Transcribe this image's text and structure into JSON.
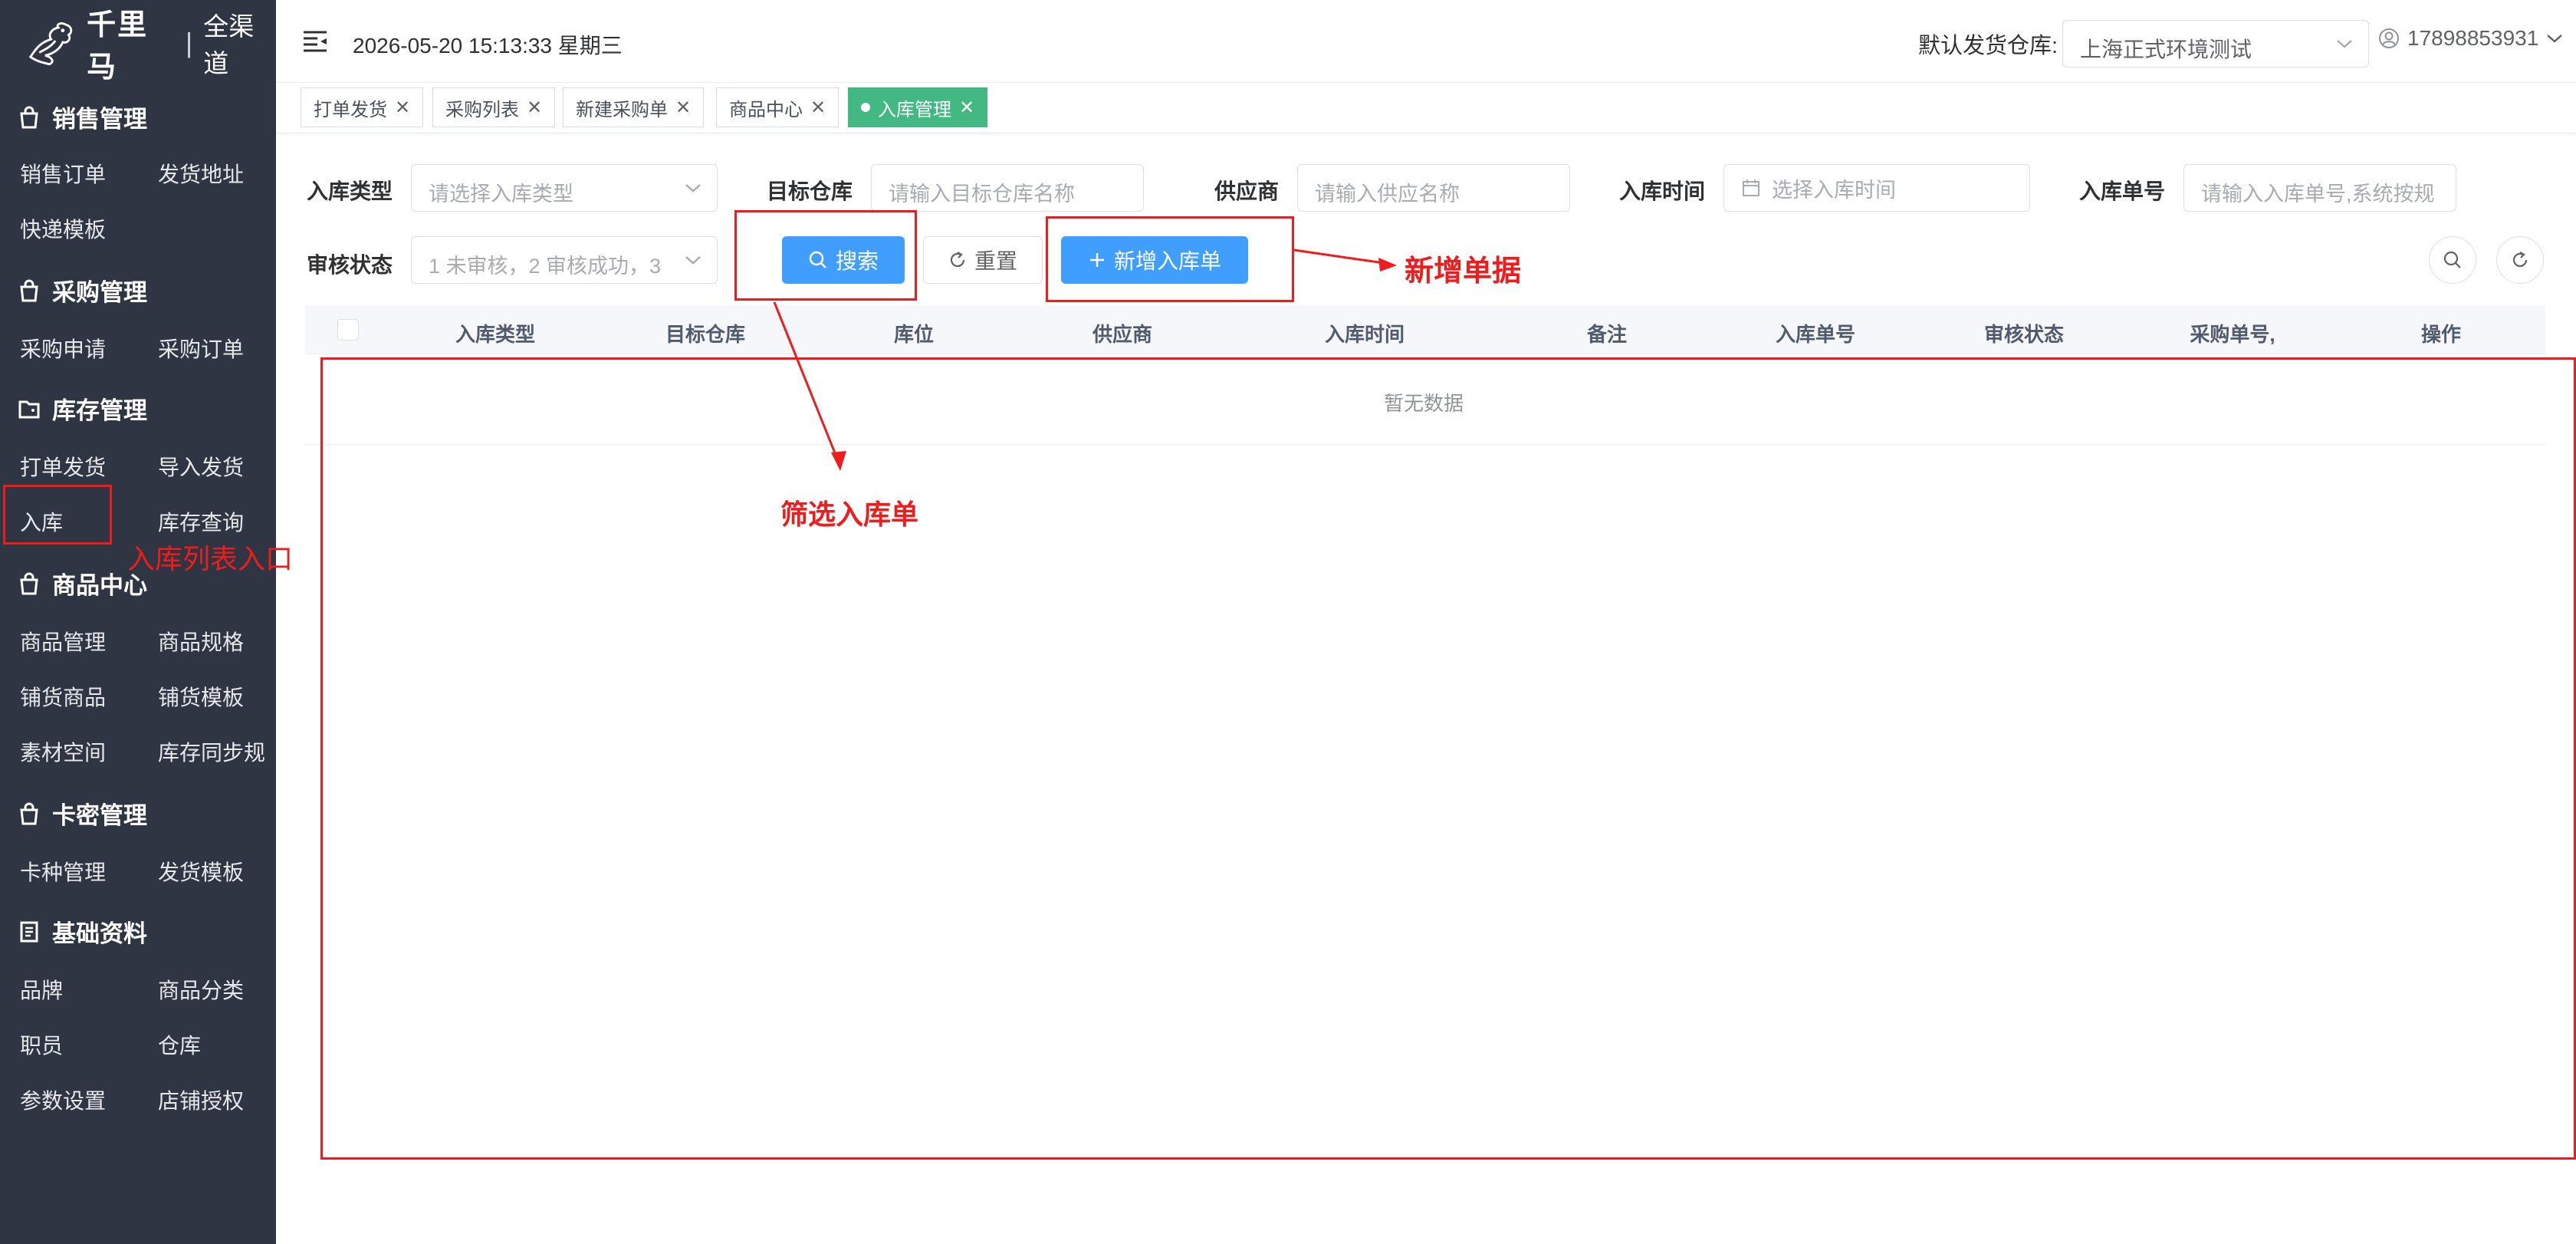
{
  "sidebar": {
    "logo": {
      "brand": "千里马",
      "separator": "|",
      "sub": "全渠道"
    },
    "groups": [
      {
        "title": "销售管理",
        "icon": "bag-icon",
        "items": [
          "销售订单",
          "发货地址",
          "快递模板"
        ]
      },
      {
        "title": "采购管理",
        "icon": "bag-icon",
        "items": [
          "采购申请",
          "采购订单"
        ]
      },
      {
        "title": "库存管理",
        "icon": "folder-icon",
        "items": [
          "打单发货",
          "导入发货",
          "入库",
          "库存查询"
        ]
      },
      {
        "title": "商品中心",
        "icon": "bag-icon",
        "items": [
          "商品管理",
          "商品规格",
          "铺货商品",
          "铺货模板",
          "素材空间",
          "库存同步规"
        ]
      },
      {
        "title": "卡密管理",
        "icon": "bag-icon",
        "items": [
          "卡种管理",
          "发货模板"
        ]
      },
      {
        "title": "基础资料",
        "icon": "document-icon",
        "items": [
          "品牌",
          "商品分类",
          "职员",
          "仓库",
          "参数设置",
          "店铺授权"
        ]
      }
    ]
  },
  "header": {
    "datetime": "2026-05-20 15:13:33 星期三",
    "warehouse_label": "默认发货仓库:",
    "warehouse_value": "上海正式环境测试",
    "user": "17898853931"
  },
  "tabs": [
    {
      "label": "打单发货",
      "active": false
    },
    {
      "label": "采购列表",
      "active": false
    },
    {
      "label": "新建采购单",
      "active": false
    },
    {
      "label": "商品中心",
      "active": false
    },
    {
      "label": "入库管理",
      "active": true
    }
  ],
  "filters": {
    "type_label": "入库类型",
    "type_placeholder": "请选择入库类型",
    "target_label": "目标仓库",
    "target_placeholder": "请输入目标仓库名称",
    "supplier_label": "供应商",
    "supplier_placeholder": "请输入供应名称",
    "time_label": "入库时间",
    "time_placeholder": "选择入库时间",
    "no_label": "入库单号",
    "no_placeholder": "请输入入库单号,系统按规",
    "audit_label": "审核状态",
    "audit_placeholder": "1 未审核，2 审核成功，3"
  },
  "actions": {
    "search": "搜索",
    "reset": "重置",
    "add": "新增入库单"
  },
  "table": {
    "columns": [
      "入库类型",
      "目标仓库",
      "库位",
      "供应商",
      "入库时间",
      "备注",
      "入库单号",
      "审核状态",
      "采购单号,",
      "操作"
    ],
    "empty": "暂无数据"
  },
  "annotations": {
    "entry": "入库列表入口",
    "filter": "筛选入库单",
    "add": "新增单据",
    "color": "#ee1c1c"
  }
}
